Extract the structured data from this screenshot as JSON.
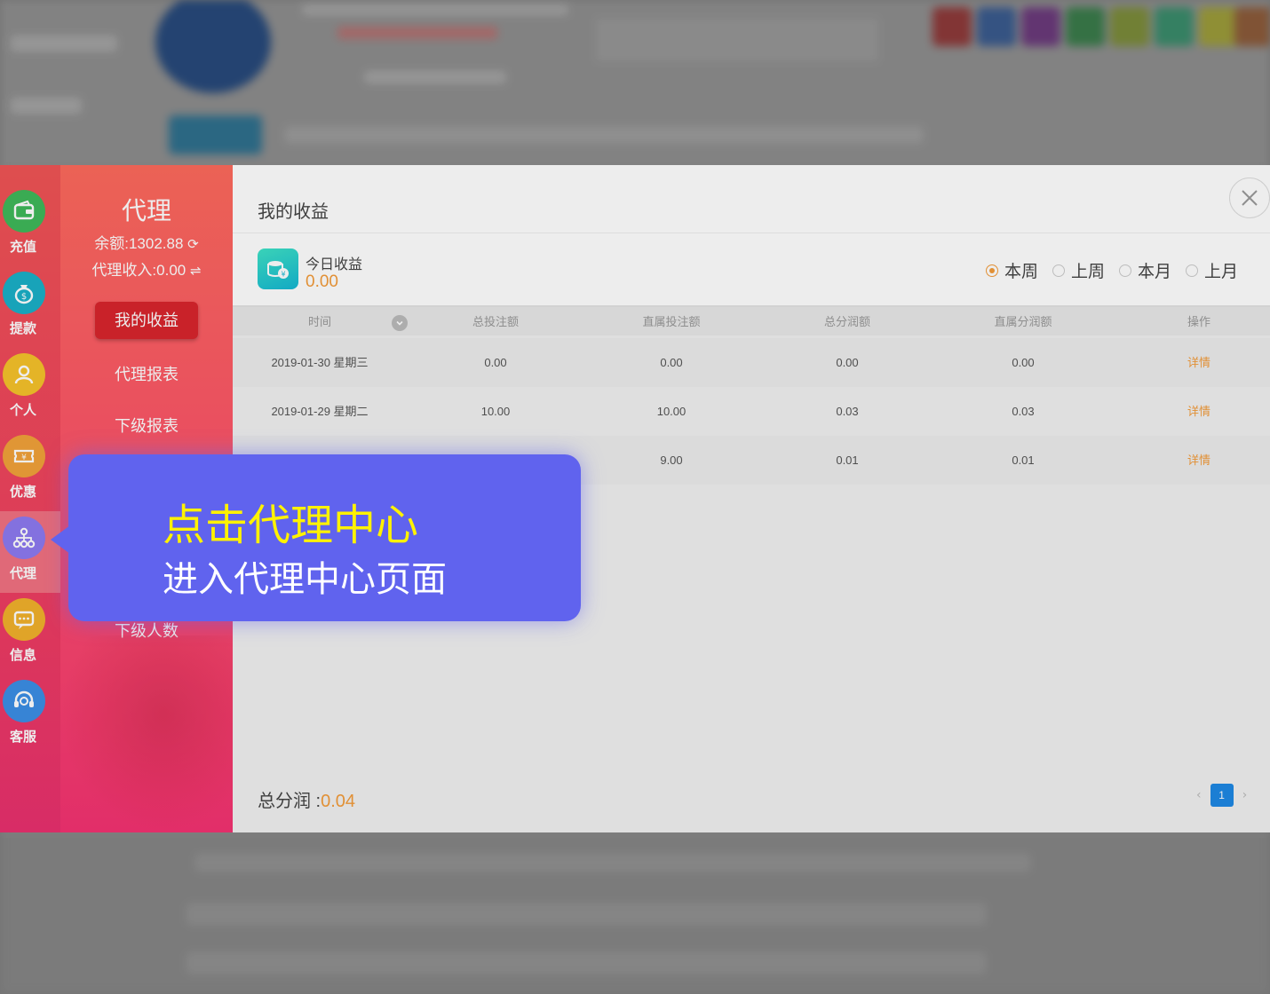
{
  "sidebar": {
    "items": [
      {
        "label": "充值",
        "icon": "wallet-icon",
        "color": "#3fb95a"
      },
      {
        "label": "提款",
        "icon": "money-bag-icon",
        "color": "#1ab0c8"
      },
      {
        "label": "个人",
        "icon": "user-icon",
        "color": "#f6c22a"
      },
      {
        "label": "优惠",
        "icon": "coupon-icon",
        "color": "#f2a23a"
      },
      {
        "label": "代理",
        "icon": "network-icon",
        "color": "#8d7af0",
        "active": true
      },
      {
        "label": "信息",
        "icon": "message-icon",
        "color": "#f2b12c"
      },
      {
        "label": "客服",
        "icon": "headset-icon",
        "color": "#3c8fe6"
      }
    ]
  },
  "agent": {
    "title": "代理",
    "balance": "余额:1302.88",
    "income": "代理收入:0.00",
    "menu": [
      "我的收益",
      "代理报表",
      "下级报表",
      "下级人数"
    ]
  },
  "content": {
    "title": "我的收益",
    "today_label": "今日收益",
    "today_value": "0.00",
    "ranges": [
      {
        "label": "本周",
        "checked": true
      },
      {
        "label": "上周",
        "checked": false
      },
      {
        "label": "本月",
        "checked": false
      },
      {
        "label": "上月",
        "checked": false
      }
    ],
    "table": {
      "headers": [
        "时间",
        "总投注额",
        "直属投注额",
        "总分润额",
        "直属分润额",
        "操作"
      ],
      "rows": [
        [
          "2019-01-30 星期三",
          "0.00",
          "0.00",
          "0.00",
          "0.00",
          "详情"
        ],
        [
          "2019-01-29 星期二",
          "10.00",
          "10.00",
          "0.03",
          "0.03",
          "详情"
        ],
        [
          "",
          "",
          "9.00",
          "0.01",
          "0.01",
          "详情"
        ]
      ]
    },
    "total_label": "总分润 :",
    "total_value": "0.04",
    "page": "1"
  },
  "callout": {
    "title": "点击代理中心",
    "subtitle": "进入代理中心页面"
  },
  "colors": {
    "accent": "#f39b3a",
    "callout_bg": "#6063ee",
    "callout_title": "#fff200",
    "agent_red": "#d9252d",
    "pager_blue": "#1e88e5"
  }
}
